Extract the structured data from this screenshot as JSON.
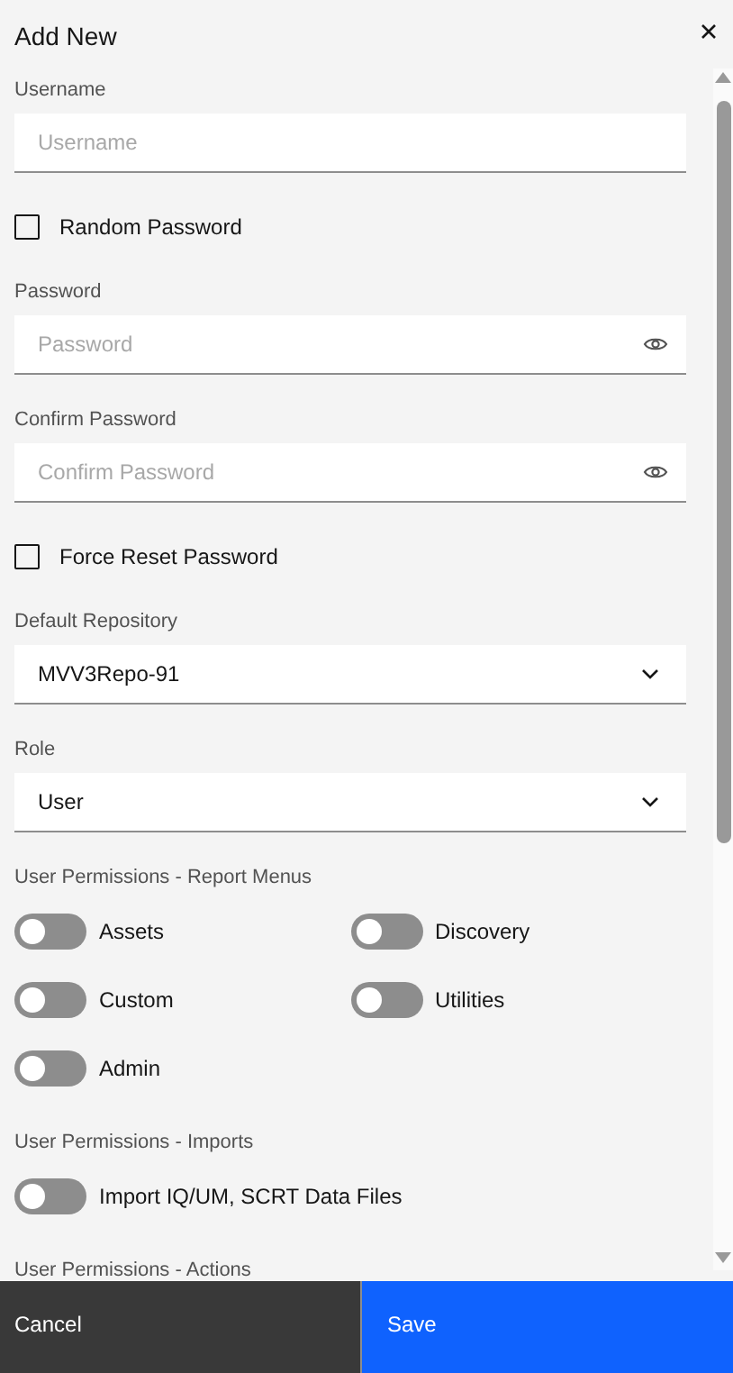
{
  "title": "Add New",
  "form": [
    {
      "kind": "text",
      "label": "Username",
      "placeholder": "Username"
    },
    {
      "kind": "checkbox",
      "label": "Random Password",
      "checked": false
    },
    {
      "kind": "password",
      "label": "Password",
      "placeholder": "Password"
    },
    {
      "kind": "password",
      "label": "Confirm Password",
      "placeholder": "Confirm Password"
    },
    {
      "kind": "checkbox",
      "label": "Force Reset Password",
      "checked": false
    },
    {
      "kind": "select",
      "label": "Default Repository",
      "value": "MVV3Repo-91"
    },
    {
      "kind": "select",
      "label": "Role",
      "value": "User"
    },
    {
      "kind": "toggles",
      "label": "User Permissions - Report Menus",
      "items": [
        {
          "label": "Assets",
          "on": false
        },
        {
          "label": "Discovery",
          "on": false
        },
        {
          "label": "Custom",
          "on": false
        },
        {
          "label": "Utilities",
          "on": false
        },
        {
          "label": "Admin",
          "on": false
        }
      ]
    },
    {
      "kind": "toggles",
      "label": "User Permissions - Imports",
      "items": [
        {
          "label": "Import IQ/UM, SCRT Data Files",
          "on": false
        }
      ]
    },
    {
      "kind": "heading",
      "label": "User Permissions - Actions"
    }
  ],
  "buttons": [
    {
      "kind": "secondary",
      "label": "Cancel"
    },
    {
      "kind": "primary",
      "label": "Save"
    }
  ]
}
